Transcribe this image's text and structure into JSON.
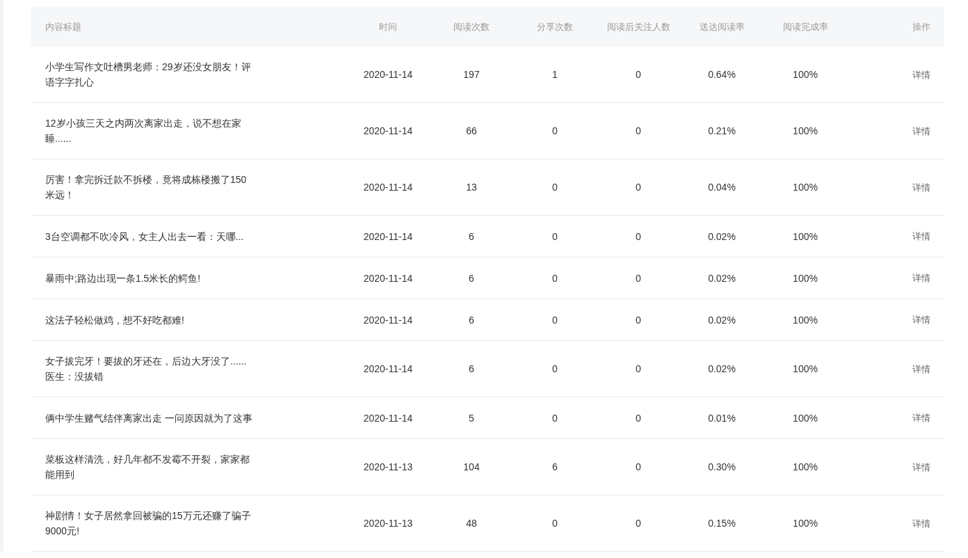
{
  "table": {
    "columns": [
      "内容标题",
      "时间",
      "阅读次数",
      "分享次数",
      "阅读后关注人数",
      "送达阅读率",
      "阅读完成率",
      "操作"
    ],
    "rows": [
      {
        "title": "小学生写作文吐槽男老师：29岁还没女朋友！评语字字扎心",
        "time": "2020-11-14",
        "reads": "197",
        "shares": "1",
        "follows": "0",
        "reach_rate": "0.64%",
        "complete_rate": "100%",
        "action": "详情"
      },
      {
        "title": "12岁小孩三天之内两次离家出走，说不想在家睡......",
        "time": "2020-11-14",
        "reads": "66",
        "shares": "0",
        "follows": "0",
        "reach_rate": "0.21%",
        "complete_rate": "100%",
        "action": "详情"
      },
      {
        "title": "厉害！拿完拆迁款不拆楼，竟将成栋楼搬了150米远！",
        "time": "2020-11-14",
        "reads": "13",
        "shares": "0",
        "follows": "0",
        "reach_rate": "0.04%",
        "complete_rate": "100%",
        "action": "详情"
      },
      {
        "title": "3台空调都不吹冷风，女主人出去一看：天哪...",
        "time": "2020-11-14",
        "reads": "6",
        "shares": "0",
        "follows": "0",
        "reach_rate": "0.02%",
        "complete_rate": "100%",
        "action": "详情"
      },
      {
        "title": "暴雨中;路边出现一条1.5米长的鳄鱼!",
        "time": "2020-11-14",
        "reads": "6",
        "shares": "0",
        "follows": "0",
        "reach_rate": "0.02%",
        "complete_rate": "100%",
        "action": "详情"
      },
      {
        "title": "这法子轻松做鸡，想不好吃都难!",
        "time": "2020-11-14",
        "reads": "6",
        "shares": "0",
        "follows": "0",
        "reach_rate": "0.02%",
        "complete_rate": "100%",
        "action": "详情"
      },
      {
        "title": "女子拔完牙！要拔的牙还在，后边大牙没了......医生：没拔错",
        "time": "2020-11-14",
        "reads": "6",
        "shares": "0",
        "follows": "0",
        "reach_rate": "0.02%",
        "complete_rate": "100%",
        "action": "详情"
      },
      {
        "title": "俩中学生赌气结伴离家出走 一问原因就为了这事",
        "time": "2020-11-14",
        "reads": "5",
        "shares": "0",
        "follows": "0",
        "reach_rate": "0.01%",
        "complete_rate": "100%",
        "action": "详情"
      },
      {
        "title": "菜板这样清洗，好几年都不发霉不开裂，家家都能用到",
        "time": "2020-11-13",
        "reads": "104",
        "shares": "6",
        "follows": "0",
        "reach_rate": "0.30%",
        "complete_rate": "100%",
        "action": "详情"
      },
      {
        "title": "神剧情！女子居然拿回被骗的15万元还赚了骗子9000元!",
        "time": "2020-11-13",
        "reads": "48",
        "shares": "0",
        "follows": "0",
        "reach_rate": "0.15%",
        "complete_rate": "100%",
        "action": "详情"
      }
    ]
  }
}
